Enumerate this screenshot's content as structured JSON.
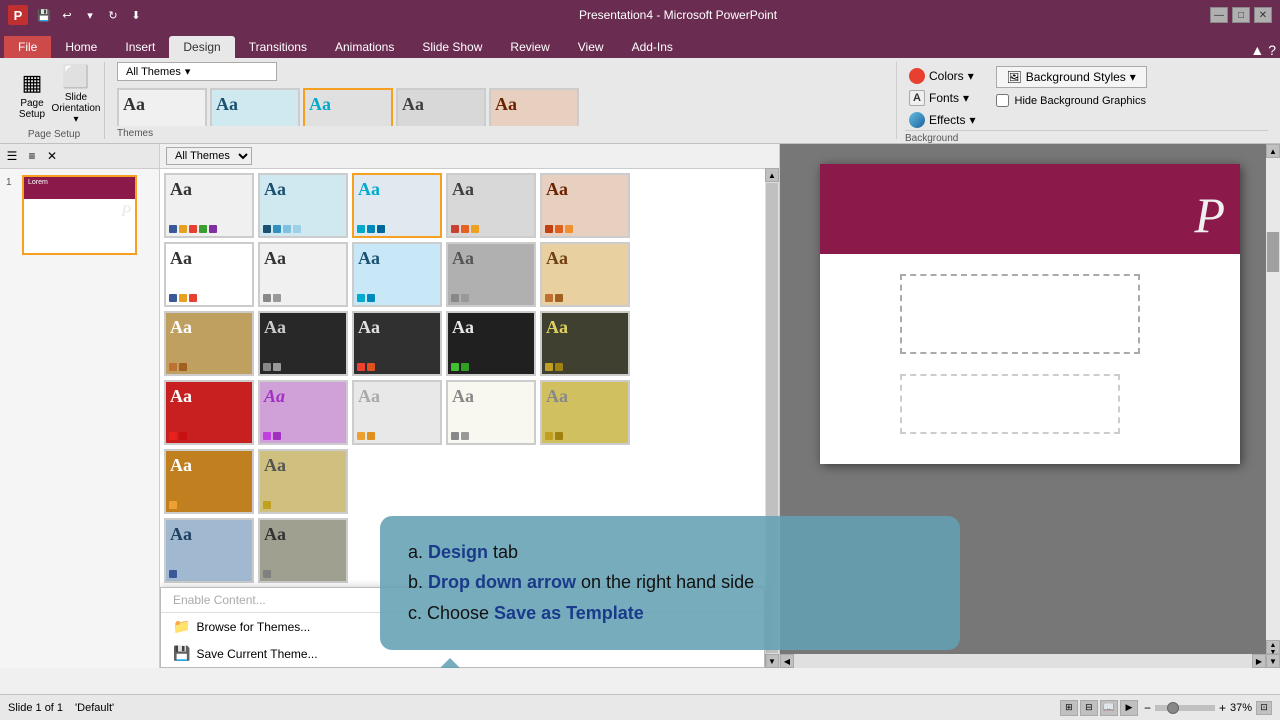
{
  "window": {
    "title": "Presentation4 - Microsoft PowerPoint"
  },
  "titlebar": {
    "title": "Presentation4 - Microsoft PowerPoint",
    "min": "—",
    "max": "□",
    "close": "✕"
  },
  "quickaccess": {
    "items": [
      "P",
      "💾",
      "↩",
      "↻",
      "⬇"
    ]
  },
  "tabs": [
    {
      "id": "file",
      "label": "File",
      "type": "file"
    },
    {
      "id": "home",
      "label": "Home",
      "type": "normal"
    },
    {
      "id": "insert",
      "label": "Insert",
      "type": "normal"
    },
    {
      "id": "design",
      "label": "Design",
      "type": "active"
    },
    {
      "id": "transitions",
      "label": "Transitions",
      "type": "normal"
    },
    {
      "id": "animations",
      "label": "Animations",
      "type": "normal"
    },
    {
      "id": "slideshow",
      "label": "Slide Show",
      "type": "normal"
    },
    {
      "id": "review",
      "label": "Review",
      "type": "normal"
    },
    {
      "id": "view",
      "label": "View",
      "type": "normal"
    },
    {
      "id": "addins",
      "label": "Add-Ins",
      "type": "normal"
    }
  ],
  "ribbon": {
    "groups": [
      {
        "id": "page-setup",
        "label": "Page Setup",
        "buttons": [
          {
            "id": "page-setup-btn",
            "label": "Page Setup",
            "icon": "▦"
          },
          {
            "id": "slide-orientation-btn",
            "label": "Slide Orientation",
            "icon": "⬜"
          }
        ]
      }
    ],
    "themes_dropdown": "All Themes",
    "right_panel": {
      "colors_label": "Colors",
      "fonts_label": "Fonts",
      "effects_label": "Effects",
      "background_styles_label": "Background Styles",
      "hide_bg_graphics_label": "Hide Background Graphics",
      "background_group_label": "Background"
    }
  },
  "themes": {
    "dropdown_label": "All Themes",
    "rows": [
      [
        {
          "bg": "#f0f0f0",
          "text": "#333",
          "dots": [
            "#3b5998",
            "#e8a020",
            "#e84030",
            "#3ba030",
            "#8030a0",
            "#c0c0c0",
            "#404040",
            "#a0a0a0"
          ]
        },
        {
          "bg": "#d0e8f0",
          "text": "#1a5070",
          "dots": [
            "#1a5070",
            "#3090c0",
            "#80c0e0",
            "#a0d0e8",
            "#c0e0f0",
            "#2060a0",
            "#104060",
            "#408090"
          ]
        },
        {
          "bg": "#e0e0e0",
          "text": "#205080",
          "dots": [
            "#00aacc",
            "#0088bb",
            "#006699",
            "#004477",
            "#002255",
            "#88ccdd",
            "#44aacc",
            "#22aacc"
          ]
        },
        {
          "bg": "#d8d8d8",
          "text": "#404040",
          "dots": [
            "#c84030",
            "#e86020",
            "#f0a020",
            "#80a030",
            "#3060a0",
            "#8060a0",
            "#606060",
            "#a0a0a0"
          ]
        },
        {
          "bg": "#e8d0c0",
          "text": "#6b2200",
          "dots": [
            "#c04010",
            "#e06020",
            "#f09030",
            "#804020",
            "#602010",
            "#a05030",
            "#804030",
            "#503020"
          ]
        }
      ],
      [
        {
          "bg": "#ffffff",
          "text": "#333",
          "dots": [
            "#3b5998",
            "#e8a020",
            "#e84030",
            "#3ba030",
            "#8030a0",
            "#c0c0c0",
            "#404040",
            "#a0a0a0"
          ]
        },
        {
          "bg": "#f8f8f8",
          "text": "#333",
          "dots": [
            "#3b5998",
            "#e8a020",
            "#e84030",
            "#3ba030",
            "#8030a0",
            "#c0c0c0",
            "#404040",
            "#a0a0a0"
          ]
        },
        {
          "bg": "#c8e8f8",
          "text": "#1a5070",
          "dots": [
            "#00aacc",
            "#0088bb",
            "#006699",
            "#004477",
            "#002255",
            "#88ccdd",
            "#44aacc",
            "#22aacc"
          ]
        },
        {
          "bg": "#b0b0b0",
          "text": "#555",
          "dots": [
            "#888",
            "#999",
            "#aaa",
            "#777",
            "#666",
            "#555",
            "#444",
            "#333"
          ]
        },
        {
          "bg": "#e8d0a0",
          "text": "#704010",
          "dots": [
            "#c07030",
            "#a06020",
            "#805020",
            "#604010",
            "#403010",
            "#e09040",
            "#d08030",
            "#c07020"
          ]
        }
      ],
      [
        {
          "bg": "#c0a060",
          "text": "#fff",
          "dots": [
            "#c07030",
            "#a06020",
            "#805020",
            "#604010",
            "#e09040",
            "#d08030",
            "#c07020",
            "#b06010"
          ]
        },
        {
          "bg": "#282828",
          "text": "#ccc",
          "dots": [
            "#888",
            "#999",
            "#aaa",
            "#777",
            "#666",
            "#555",
            "#444",
            "#333"
          ]
        },
        {
          "bg": "#303030",
          "text": "#e0e0e0",
          "dots": [
            "#f04030",
            "#e05020",
            "#c04010",
            "#a03000",
            "#802000",
            "#ff6050",
            "#ff5040",
            "#ff4030"
          ]
        },
        {
          "bg": "#202020",
          "text": "#e8e8e8",
          "dots": [
            "#40c030",
            "#30a020",
            "#208010",
            "#106000",
            "#084000",
            "#60e050",
            "#50d040",
            "#40c030"
          ]
        },
        {
          "bg": "#404030",
          "text": "#e0d060",
          "dots": [
            "#c0a020",
            "#a08010",
            "#806000",
            "#604800",
            "#403000",
            "#e0c030",
            "#d0b020",
            "#c0a010"
          ]
        }
      ],
      [
        {
          "bg": "#c82020",
          "text": "#fff",
          "dots": [
            "#e82020",
            "#c81010",
            "#a80000",
            "#880000",
            "#600000",
            "#ff4030",
            "#ff3020",
            "#ff2010"
          ]
        },
        {
          "bg": "#a030c0",
          "text": "#fff",
          "dots": [
            "#c040e0",
            "#a030c0",
            "#8020a0",
            "#601080",
            "#400060",
            "#e060ff",
            "#d050f0",
            "#c040e0"
          ]
        },
        {
          "bg": "#e8e8e8",
          "text": "#aaa",
          "dots": [
            "#f0a030",
            "#e09020",
            "#d08010",
            "#c07000",
            "#a05000",
            "#ffb040",
            "#ffa030",
            "#ff9020"
          ]
        },
        {
          "bg": "#f8f8f0",
          "text": "#888",
          "dots": [
            "#888",
            "#999",
            "#aaa",
            "#bbb",
            "#ccc",
            "#777",
            "#666",
            "#555"
          ]
        },
        {
          "bg": "#d0c060",
          "text": "#888",
          "dots": [
            "#c0a020",
            "#a08010",
            "#806000",
            "#604800",
            "#403000",
            "#e0c030",
            "#d0b020",
            "#c0a010"
          ]
        }
      ],
      [
        {
          "bg": "#c08020",
          "text": "#fff",
          "dots": [
            "#f0a030",
            "#e09020",
            "#d08010",
            "#c07000",
            "#a05000",
            "#ffb040",
            "#ffa030",
            "#ff9020"
          ]
        },
        {
          "bg": "#d0c080",
          "text": "#555",
          "dots": [
            "#c0a020",
            "#a08010",
            "#806000",
            "#604800",
            "#403000",
            "#e0c030",
            "#d0b020",
            "#c0a010"
          ]
        }
      ],
      [
        {
          "bg": "#a0b8d0",
          "text": "#204060",
          "dots": [
            "#3b5998",
            "#2a4887",
            "#193676",
            "#082465",
            "#001254",
            "#6080b0",
            "#5070a0",
            "#406090"
          ]
        },
        {
          "bg": "#a0a090",
          "text": "#333",
          "dots": [
            "#808080",
            "#707070",
            "#606060",
            "#505050",
            "#404040",
            "#909090",
            "#a0a0a0",
            "#b0b0b0"
          ]
        }
      ]
    ]
  },
  "slide": {
    "number": "1",
    "title": "Default"
  },
  "statusbar": {
    "slide_info": "Slide 1 of 1",
    "theme": "'Default'",
    "zoom": "37%"
  },
  "callout": {
    "line_a": "a. Design tab",
    "line_b_prefix": "b. ",
    "line_b_bold": "Drop down arrow",
    "line_b_suffix": " on the right hand side",
    "line_c_prefix": "c. Choose ",
    "line_c_bold": "Save as Template"
  },
  "dropdown_menu": {
    "items": [
      {
        "id": "enable-content",
        "label": "Enable Content...",
        "disabled": true
      },
      {
        "id": "browse-themes",
        "label": "Browse for Themes...",
        "icon": "📁"
      },
      {
        "id": "save-current-theme",
        "label": "Save Current Theme...",
        "icon": "💾"
      }
    ]
  },
  "right_panel": {
    "colors_label": "Colors",
    "fonts_label": "Fonts",
    "effects_label": "Effects",
    "bg_styles_label": "Background Styles",
    "hide_bg_label": "Hide Background Graphics",
    "bg_group_label": "Background"
  }
}
